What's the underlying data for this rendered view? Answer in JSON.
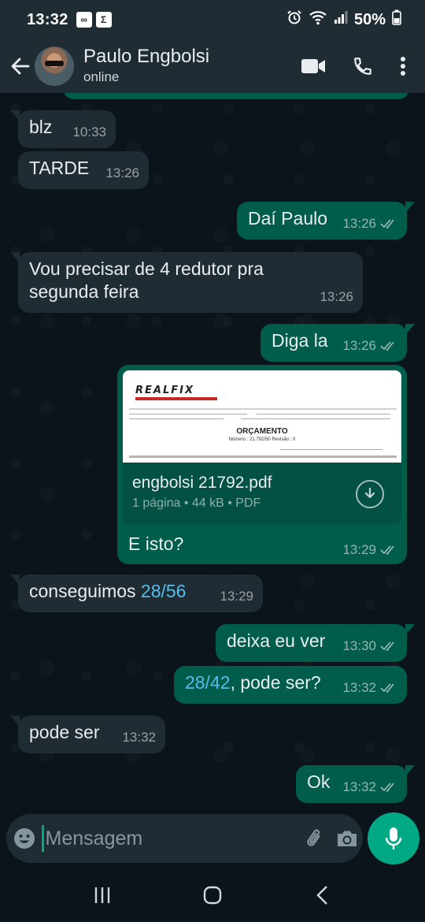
{
  "status_bar": {
    "time": "13:32",
    "badge_1": "∞",
    "badge_2": "Σ",
    "battery": "50%"
  },
  "header": {
    "contact_name": "Paulo Engbolsi",
    "contact_status": "online"
  },
  "messages": [
    {
      "id": 1,
      "direction": "in",
      "text": "blz",
      "time": "10:33"
    },
    {
      "id": 2,
      "direction": "in",
      "text": "TARDE",
      "time": "13:26"
    },
    {
      "id": 3,
      "direction": "out",
      "text": "Daí Paulo",
      "time": "13:26",
      "status": "read"
    },
    {
      "id": 4,
      "direction": "in",
      "text_line1": "Vou precisar de 4 redutor pra",
      "text_line2": "segunda feira",
      "time": "13:26"
    },
    {
      "id": 5,
      "direction": "out",
      "text": "Diga la",
      "time": "13:26",
      "status": "read"
    },
    {
      "id": 6,
      "direction": "out",
      "type": "document",
      "preview": {
        "logo": "REALFIX",
        "title": "ORÇAMENTO",
        "subtitle": "Número :   21.792/50        Revisão :   0"
      },
      "file_name": "engbolsi 21792.pdf",
      "file_details": "1 página • 44 kB • PDF",
      "caption": "E isto?",
      "time": "13:29",
      "status": "read"
    },
    {
      "id": 7,
      "direction": "in",
      "text_prefix": "conseguimos ",
      "text_link": "28/56",
      "time": "13:29"
    },
    {
      "id": 8,
      "direction": "out",
      "text": "deixa eu ver",
      "time": "13:30",
      "status": "read"
    },
    {
      "id": 9,
      "direction": "out",
      "text_link": "28/42",
      "text_suffix": ", pode ser?",
      "time": "13:32",
      "status": "read"
    },
    {
      "id": 10,
      "direction": "in",
      "text": "pode ser",
      "time": "13:32"
    },
    {
      "id": 11,
      "direction": "out",
      "text": "Ok",
      "time": "13:32",
      "status": "read"
    }
  ],
  "input": {
    "placeholder": "Mensagem",
    "value": ""
  },
  "colors": {
    "incoming_bubble": "#202c33",
    "outgoing_bubble": "#005c4b",
    "accent": "#00a884",
    "link": "#53bdeb"
  },
  "icons": {
    "back": "arrow-left-icon",
    "video": "video-call-icon",
    "call": "phone-icon",
    "menu": "more-vertical-icon",
    "read": "double-check-icon",
    "download": "download-icon",
    "emoji": "emoji-icon",
    "attach": "paperclip-icon",
    "camera": "camera-icon",
    "mic": "microphone-icon"
  }
}
